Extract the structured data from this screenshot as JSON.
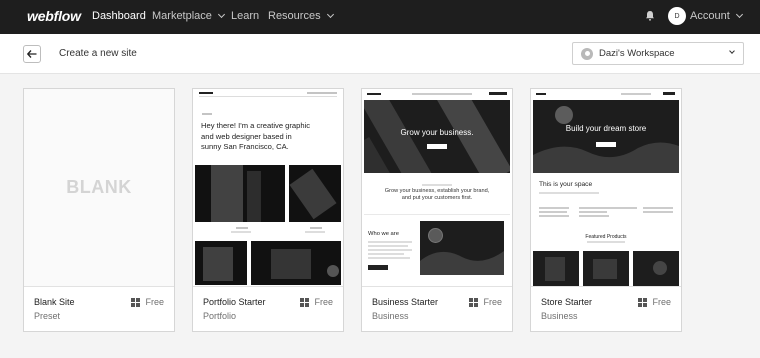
{
  "nav": {
    "logo": "webflow",
    "items": [
      {
        "label": "Dashboard",
        "active": true,
        "dropdown": false
      },
      {
        "label": "Marketplace",
        "active": false,
        "dropdown": true
      },
      {
        "label": "Learn",
        "active": false,
        "dropdown": false
      },
      {
        "label": "Resources",
        "active": false,
        "dropdown": true
      }
    ],
    "avatar_initial": "D",
    "account_label": "Account",
    "icons": [
      "bell-icon",
      "chevron-down-icon"
    ]
  },
  "header": {
    "back_icon": "arrow-left-icon",
    "title": "Create a new site",
    "workspace": "Dazi's Workspace"
  },
  "templates": [
    {
      "name": "Blank Site",
      "category": "Preset",
      "price": "Free",
      "thumb_text": "BLANK"
    },
    {
      "name": "Portfolio Starter",
      "category": "Portfolio",
      "price": "Free",
      "thumb_text": "Hey there! I'm a creative graphic and web designer based in sunny San Francisco, CA."
    },
    {
      "name": "Business Starter",
      "category": "Business",
      "price": "Free",
      "thumb_text": "Grow your business.",
      "thumb_sub": "Grow your business, establish your brand, and put your customers first.",
      "thumb_section": "Who we are"
    },
    {
      "name": "Store Starter",
      "category": "Business",
      "price": "Free",
      "thumb_text": "Build your dream store",
      "thumb_sub": "This is your space",
      "thumb_section": "Featured Products"
    }
  ],
  "colors": {
    "nav_bg": "#1e1e1e",
    "page_bg": "#f4f4f4",
    "card_border": "#d6d6d6"
  }
}
